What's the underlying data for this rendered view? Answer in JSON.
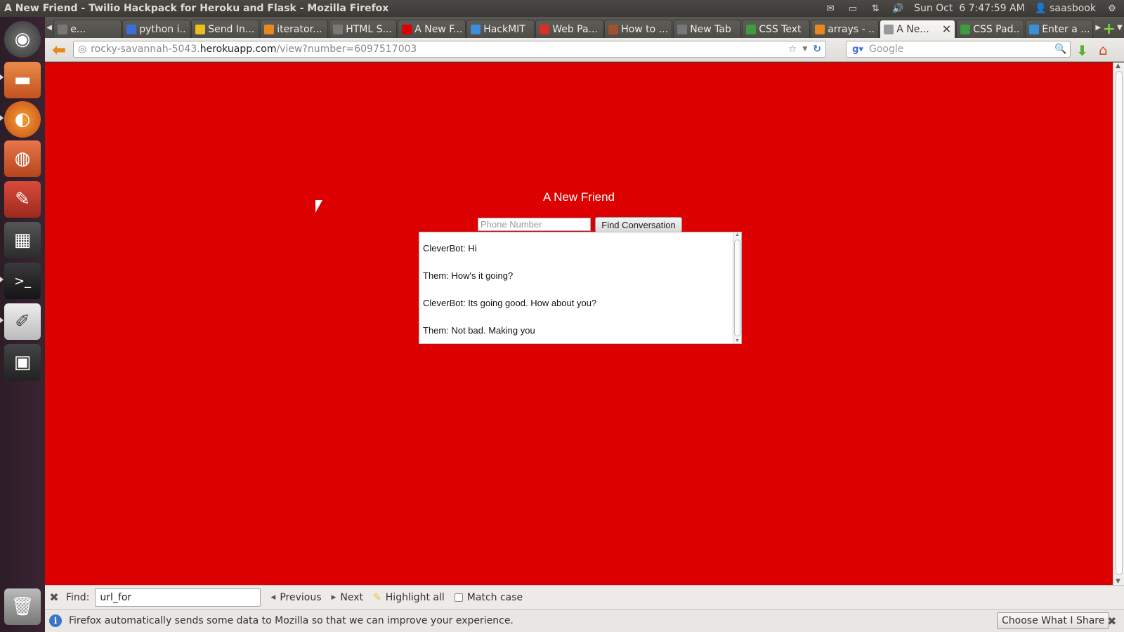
{
  "window": {
    "title": "A New Friend - Twilio Hackpack for Heroku and Flask - Mozilla Firefox"
  },
  "panel": {
    "datetime": "Sun Oct  6 7:47:59 AM",
    "user": "saasbook"
  },
  "tabs": [
    {
      "label": "e...",
      "icon": "document-icon",
      "color": "#777777"
    },
    {
      "label": "python i...",
      "icon": "google-icon",
      "color": "#3b6fd8"
    },
    {
      "label": "Send In...",
      "icon": "smiley-icon",
      "color": "#e8c020"
    },
    {
      "label": "iterator...",
      "icon": "stackoverflow-icon",
      "color": "#e8871e"
    },
    {
      "label": "HTML S...",
      "icon": "blank-page-icon",
      "color": "#777777"
    },
    {
      "label": "A New F...",
      "icon": "red-dot-icon",
      "color": "#dc0000"
    },
    {
      "label": "HackMIT",
      "icon": "chrome-icon",
      "color": "#3b8ed8"
    },
    {
      "label": "Web Pa...",
      "icon": "gmail-icon",
      "color": "#d93025"
    },
    {
      "label": "How to ...",
      "icon": "bug-icon",
      "color": "#a0522d"
    },
    {
      "label": "New Tab",
      "icon": "blank-page-icon",
      "color": "#777777"
    },
    {
      "label": "CSS Text",
      "icon": "w3-icon",
      "color": "#3e9b3e"
    },
    {
      "label": "arrays - ...",
      "icon": "stackoverflow-icon",
      "color": "#e8871e"
    },
    {
      "label": "A Ne...",
      "icon": "loading-icon",
      "color": "#999999",
      "active": true
    },
    {
      "label": "CSS Pad...",
      "icon": "w3-icon",
      "color": "#3e9b3e"
    },
    {
      "label": "Enter a ...",
      "icon": "chrome-icon",
      "color": "#3b8ed8"
    }
  ],
  "urlbar": {
    "host_prefix": "rocky-savannah-5043.",
    "host": "herokuapp.com",
    "path": "/view?number=6097517003"
  },
  "searchbar": {
    "placeholder": "Google"
  },
  "page": {
    "heading": "A New Friend",
    "phone_placeholder": "Phone Number",
    "find_button": "Find Conversation",
    "conversation": [
      "CleverBot: Hi",
      "Them: How's it going?",
      "CleverBot: Its going good. How about you?",
      "Them: Not bad. Making you"
    ],
    "background": "#dc0000"
  },
  "findbar": {
    "label": "Find:",
    "value": "url_for",
    "previous": "Previous",
    "next": "Next",
    "highlight": "Highlight all",
    "match_case": "Match case"
  },
  "notification": {
    "message": "Firefox automatically sends some data to Mozilla so that we can improve your experience.",
    "button": "Choose What I Share"
  }
}
